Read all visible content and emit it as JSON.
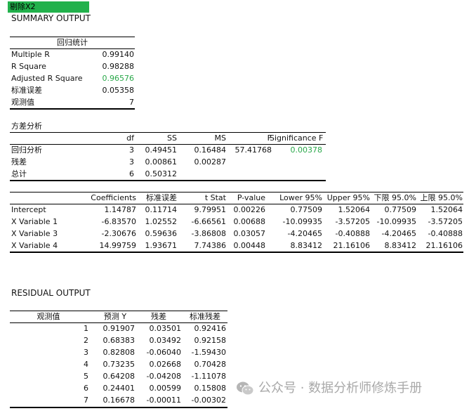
{
  "sheet_tab": "剔除X2",
  "summary_title": "SUMMARY OUTPUT",
  "regression_stats": {
    "header": "回归统计",
    "rows": [
      {
        "label": "Multiple R",
        "value": "0.99140"
      },
      {
        "label": "R Square",
        "value": "0.98288"
      },
      {
        "label": "Adjusted R Square",
        "value": "0.96576"
      },
      {
        "label": "标准误差",
        "value": "0.05358"
      },
      {
        "label": "观测值",
        "value": "7"
      }
    ],
    "highlight_color": "#2aa84a"
  },
  "anova": {
    "title": "方差分析",
    "headers": [
      "df",
      "SS",
      "MS",
      "F",
      "Significance F"
    ],
    "rows": [
      {
        "label": "回归分析",
        "df": "3",
        "ss": "0.49451",
        "ms": "0.16484",
        "f": "57.41768",
        "sig": "0.00378"
      },
      {
        "label": "残差",
        "df": "3",
        "ss": "0.00861",
        "ms": "0.00287",
        "f": "",
        "sig": ""
      },
      {
        "label": "总计",
        "df": "6",
        "ss": "0.50312",
        "ms": "",
        "f": "",
        "sig": ""
      }
    ]
  },
  "coef": {
    "headers": [
      "Coefficients",
      "标准误差",
      "t Stat",
      "P-value",
      "Lower 95%",
      "Upper 95%",
      "下限 95.0%",
      "上限 95.0%"
    ],
    "rows": [
      {
        "label": "Intercept",
        "v": [
          "1.14787",
          "0.11714",
          "9.79951",
          "0.00226",
          "0.77509",
          "1.52064",
          "0.77509",
          "1.52064"
        ]
      },
      {
        "label": "X Variable 1",
        "v": [
          "-6.83570",
          "1.02552",
          "-6.66561",
          "0.00688",
          "-10.09935",
          "-3.57205",
          "-10.09935",
          "-3.57205"
        ]
      },
      {
        "label": "X Variable 3",
        "v": [
          "-2.30676",
          "0.59636",
          "-3.86808",
          "0.03057",
          "-4.20465",
          "-0.40888",
          "-4.20465",
          "-0.40888"
        ]
      },
      {
        "label": "X Variable 4",
        "v": [
          "14.99759",
          "1.93671",
          "7.74386",
          "0.00448",
          "8.83412",
          "21.16106",
          "8.83412",
          "21.16106"
        ]
      }
    ]
  },
  "residual": {
    "title": "RESIDUAL OUTPUT",
    "headers": [
      "观测值",
      "预测 Y",
      "残差",
      "标准残差"
    ],
    "rows": [
      [
        "1",
        "0.91907",
        "0.03501",
        "0.92416"
      ],
      [
        "2",
        "0.68383",
        "0.03492",
        "0.92158"
      ],
      [
        "3",
        "0.82808",
        "-0.06040",
        "-1.59430"
      ],
      [
        "4",
        "0.73235",
        "0.02668",
        "0.70428"
      ],
      [
        "5",
        "0.64208",
        "-0.04208",
        "-1.11078"
      ],
      [
        "6",
        "0.24401",
        "0.00599",
        "0.15808"
      ],
      [
        "7",
        "0.16678",
        "-0.00011",
        "-0.00302"
      ]
    ]
  },
  "watermark": "公众号 · 数据分析师修炼手册",
  "watermark_icon": "wechat-icon"
}
